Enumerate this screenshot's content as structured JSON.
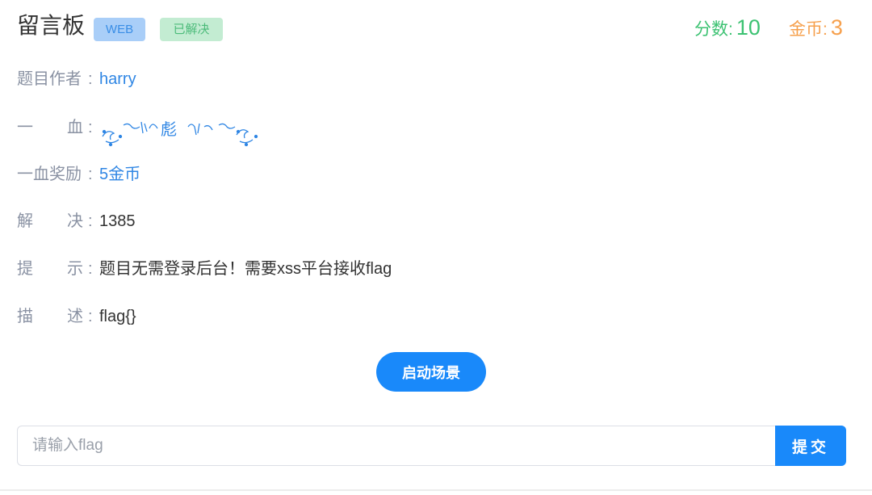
{
  "challenge": {
    "title": "留言板",
    "category_badge": "WEB",
    "status_badge": "已解决"
  },
  "stats": {
    "score_label": "分数:",
    "score_value": "10",
    "coin_label": "金币:",
    "coin_value": "3"
  },
  "details": {
    "author_label": "题目作者",
    "author_value": "harry",
    "first_blood_label": [
      "一",
      "血"
    ],
    "first_blood_value": "ミ彪ミ",
    "first_blood_reward_label": "一血奖励",
    "first_blood_reward_value": "5金币",
    "solved_label": [
      "解",
      "决"
    ],
    "solved_value": "1385",
    "hint_label": [
      "提",
      "示"
    ],
    "hint_value": "题目无需登录后台！需要xss平台接收flag",
    "description_label": [
      "描",
      "述"
    ],
    "description_value": "flag{}"
  },
  "actions": {
    "start_scene_label": "启动场景",
    "flag_placeholder": "请输入flag",
    "flag_value": "",
    "submit_label": "提交"
  },
  "colors": {
    "primary": "#1989fa",
    "score": "#3cc272",
    "coin": "#f6a04d",
    "link": "#2f86e4"
  }
}
